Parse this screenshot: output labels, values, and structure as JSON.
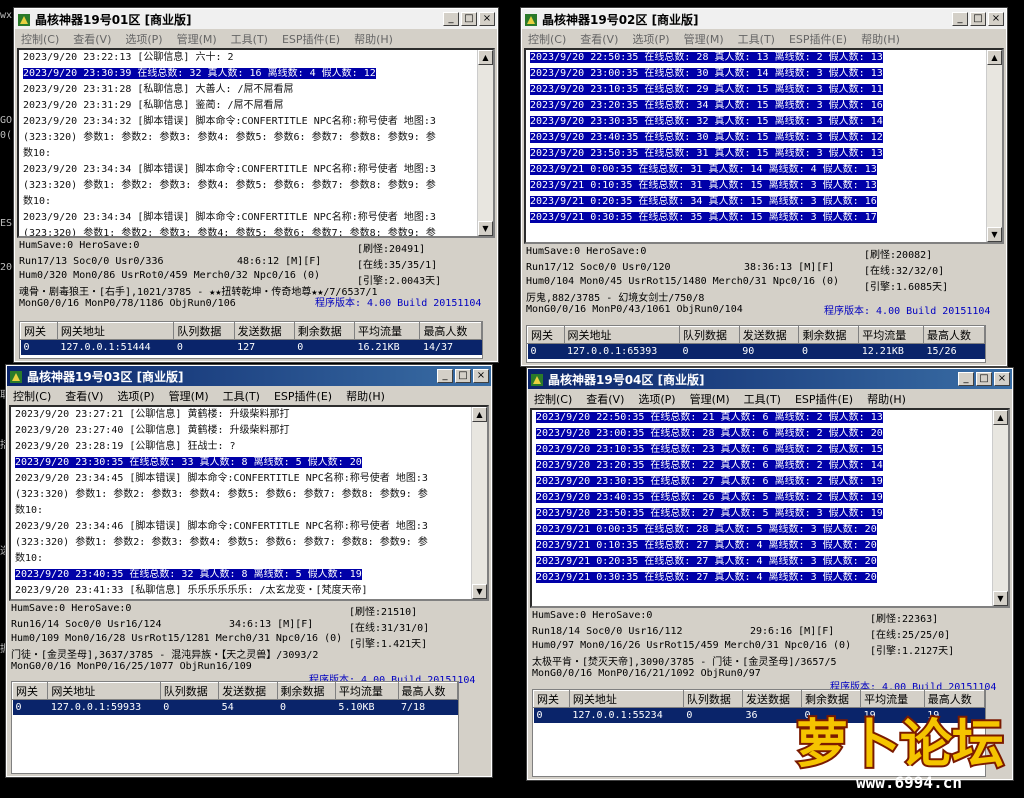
{
  "menus": [
    "控制(C)",
    "查看(V)",
    "选项(P)",
    "管理(M)",
    "工具(T)",
    "ESP插件(E)",
    "帮助(H)"
  ],
  "grid_headers": [
    "网关",
    "网关地址",
    "队列数据",
    "发送数据",
    "剩余数据",
    "平均流量",
    "最高人数"
  ],
  "title_buttons": {
    "min": "_",
    "max": "□",
    "close": "×"
  },
  "desktop_glyphs": [
    "wx",
    "GO",
    "0(",
    "ESP",
    "20",
    "取",
    "括",
    "选",
    "据"
  ],
  "windows": [
    {
      "title": "晶核神器19号01区 [商业版]",
      "log": [
        {
          "t": "2023/9/20 23:22:13 [公聊信息] 六十: 2",
          "hl": false
        },
        {
          "t": "2023/9/20 23:30:39 在线总数: 32 真人数: 16 离线数: 4 假人数: 12",
          "hl": true
        },
        {
          "t": "2023/9/20 23:31:28 [私聊信息] 大善人: /屌不屌看屌",
          "hl": false
        },
        {
          "t": "2023/9/20 23:31:29 [私聊信息] 鉴蔺: /屌不屌看屌",
          "hl": false
        },
        {
          "t": "2023/9/20 23:34:32 [脚本错误] 脚本命令:CONFERTITLE NPC名称:称号使者 地图:3",
          "hl": false
        },
        {
          "t": "(323:320) 参数1: 参数2: 参数3: 参数4: 参数5: 参数6: 参数7: 参数8: 参数9: 参",
          "hl": false
        },
        {
          "t": "数10:",
          "hl": false
        },
        {
          "t": "2023/9/20 23:34:34 [脚本错误] 脚本命令:CONFERTITLE NPC名称:称号使者 地图:3",
          "hl": false
        },
        {
          "t": "(323:320) 参数1: 参数2: 参数3: 参数4: 参数5: 参数6: 参数7: 参数8: 参数9: 参",
          "hl": false
        },
        {
          "t": "数10:",
          "hl": false
        },
        {
          "t": "2023/9/20 23:34:34 [脚本错误] 脚本命令:CONFERTITLE NPC名称:称号使者 地图:3",
          "hl": false
        },
        {
          "t": "(323:320) 参数1: 参数2: 参数3: 参数4: 参数5: 参数6: 参数7: 参数8: 参数9: 参",
          "hl": false
        }
      ],
      "status": {
        "l1": "HumSave:0 HeroSave:0",
        "l2": "Run17/13 Soc0/0 Usr0/336",
        "time": "48:6:12 [M][F]",
        "l3": "Hum0/320 Mon0/86 UsrRot0/459 Merch0/32 Npc0/16 (0)",
        "l4": "魂骨・剧毒狼王・[右手],1021/3785 - ★★扭转乾坤・传奇地尊★★/7/6537/1",
        "l5": "MonG0/0/16 MonP0/78/1186 ObjRun0/106",
        "r1": "[刷怪:20491]",
        "r2": "[在线:35/35/1]",
        "r3": "[引擎:2.0043天]",
        "ver": "程序版本: 4.00 Build 20151104"
      },
      "grid_row": [
        "0",
        "127.0.0.1:51444",
        "0",
        "127",
        "0",
        "16.21KB",
        "14/37"
      ]
    },
    {
      "title": "晶核神器19号02区 [商业版]",
      "log": [
        {
          "t": "2023/9/20 22:50:35 在线总数: 28 真人数: 13 离线数: 2 假人数: 13",
          "hl": true
        },
        {
          "t": "2023/9/20 23:00:35 在线总数: 30 真人数: 14 离线数: 3 假人数: 13",
          "hl": true
        },
        {
          "t": "2023/9/20 23:10:35 在线总数: 29 真人数: 15 离线数: 3 假人数: 11",
          "hl": true
        },
        {
          "t": "2023/9/20 23:20:35 在线总数: 34 真人数: 15 离线数: 3 假人数: 16",
          "hl": true
        },
        {
          "t": "2023/9/20 23:30:35 在线总数: 32 真人数: 15 离线数: 3 假人数: 14",
          "hl": true
        },
        {
          "t": "2023/9/20 23:40:35 在线总数: 30 真人数: 15 离线数: 3 假人数: 12",
          "hl": true
        },
        {
          "t": "2023/9/20 23:50:35 在线总数: 31 真人数: 15 离线数: 3 假人数: 13",
          "hl": true
        },
        {
          "t": "2023/9/21 0:00:35 在线总数: 31 真人数: 14 离线数: 4 假人数: 13",
          "hl": true
        },
        {
          "t": "2023/9/21 0:10:35 在线总数: 31 真人数: 15 离线数: 3 假人数: 13",
          "hl": true
        },
        {
          "t": "2023/9/21 0:20:35 在线总数: 34 真人数: 15 离线数: 3 假人数: 16",
          "hl": true
        },
        {
          "t": "2023/9/21 0:30:35 在线总数: 35 真人数: 15 离线数: 3 假人数: 17",
          "hl": true
        }
      ],
      "status": {
        "l1": "HumSave:0 HeroSave:0",
        "l2": "Run17/12 Soc0/0 Usr0/120",
        "time": "38:36:13 [M][F]",
        "l3": "Hum0/104 Mon0/45 UsrRot15/1480 Merch0/31 Npc0/16 (0)",
        "l4": "厉鬼,882/3785 - 幻境女剑士/750/8",
        "l5": "MonG0/0/16 MonP0/43/1061 ObjRun0/104",
        "r1": "[刷怪:20082]",
        "r2": "[在线:32/32/0]",
        "r3": "[引擎:1.6085天]",
        "ver": "程序版本: 4.00 Build 20151104"
      },
      "grid_row": [
        "0",
        "127.0.0.1:65393",
        "0",
        "90",
        "0",
        "12.21KB",
        "15/26"
      ]
    },
    {
      "title": "晶核神器19号03区 [商业版]",
      "log": [
        {
          "t": "2023/9/20 23:27:21 [公聊信息] 黄鹤楼: 升级柴料那打",
          "hl": false
        },
        {
          "t": "2023/9/20 23:27:40 [公聊信息] 黄鹤楼: 升级柴料那打",
          "hl": false
        },
        {
          "t": "2023/9/20 23:28:19 [公聊信息] 狂战士: ?",
          "hl": false
        },
        {
          "t": "2023/9/20 23:30:35 在线总数: 33 真人数: 8 离线数: 5 假人数: 20",
          "hl": true
        },
        {
          "t": "2023/9/20 23:34:45 [脚本错误] 脚本命令:CONFERTITLE NPC名称:称号使者 地图:3",
          "hl": false
        },
        {
          "t": "(323:320) 参数1: 参数2: 参数3: 参数4: 参数5: 参数6: 参数7: 参数8: 参数9: 参",
          "hl": false
        },
        {
          "t": "数10:",
          "hl": false
        },
        {
          "t": "2023/9/20 23:34:46 [脚本错误] 脚本命令:CONFERTITLE NPC名称:称号使者 地图:3",
          "hl": false
        },
        {
          "t": "(323:320) 参数1: 参数2: 参数3: 参数4: 参数5: 参数6: 参数7: 参数8: 参数9: 参",
          "hl": false
        },
        {
          "t": "数10:",
          "hl": false
        },
        {
          "t": "2023/9/20 23:40:35 在线总数: 32 真人数: 8 离线数: 5 假人数: 19",
          "hl": true
        },
        {
          "t": "2023/9/20 23:41:33 [私聊信息] 乐乐乐乐乐乐: /太玄龙变・[梵度天帝]",
          "hl": false
        }
      ],
      "status": {
        "l1": "HumSave:0 HeroSave:0",
        "l2": "Run16/14 Soc0/0 Usr16/124",
        "time": "34:6:13 [M][F]",
        "l3": "Hum0/109 Mon0/16/28 UsrRot15/1281 Merch0/31 Npc0/16 (0)",
        "l4": "门徒・[金灵圣母],3637/3785 - 混沌异族・【天之灵兽】/3093/2",
        "l5": "MonG0/0/16 MonP0/16/25/1077 ObjRun16/109",
        "r1": "[刷怪:21510]",
        "r2": "[在线:31/31/0]",
        "r3": "[引擎:1.421天]",
        "ver": "程序版本: 4.00 Build 20151104"
      },
      "grid_row": [
        "0",
        "127.0.0.1:59933",
        "0",
        "54",
        "0",
        "5.10KB",
        "7/18"
      ]
    },
    {
      "title": "晶核神器19号04区 [商业版]",
      "log": [
        {
          "t": "2023/9/20 22:50:35 在线总数: 21 真人数: 6 离线数: 2 假人数: 13",
          "hl": true
        },
        {
          "t": "2023/9/20 23:00:35 在线总数: 28 真人数: 6 离线数: 2 假人数: 20",
          "hl": true
        },
        {
          "t": "2023/9/20 23:10:35 在线总数: 23 真人数: 6 离线数: 2 假人数: 15",
          "hl": true
        },
        {
          "t": "2023/9/20 23:20:35 在线总数: 22 真人数: 6 离线数: 2 假人数: 14",
          "hl": true
        },
        {
          "t": "2023/9/20 23:30:35 在线总数: 27 真人数: 6 离线数: 2 假人数: 19",
          "hl": true
        },
        {
          "t": "2023/9/20 23:40:35 在线总数: 26 真人数: 5 离线数: 2 假人数: 19",
          "hl": true
        },
        {
          "t": "2023/9/20 23:50:35 在线总数: 27 真人数: 5 离线数: 3 假人数: 19",
          "hl": true
        },
        {
          "t": "2023/9/21 0:00:35 在线总数: 28 真人数: 5 离线数: 3 假人数: 20",
          "hl": true
        },
        {
          "t": "2023/9/21 0:10:35 在线总数: 27 真人数: 4 离线数: 3 假人数: 20",
          "hl": true
        },
        {
          "t": "2023/9/21 0:20:35 在线总数: 27 真人数: 4 离线数: 3 假人数: 20",
          "hl": true
        },
        {
          "t": "2023/9/21 0:30:35 在线总数: 27 真人数: 4 离线数: 3 假人数: 20",
          "hl": true
        }
      ],
      "status": {
        "l1": "HumSave:0 HeroSave:0",
        "l2": "Run18/14 Soc0/0 Usr16/112",
        "time": "29:6:16 [M][F]",
        "l3": "Hum0/97 Mon0/16/26 UsrRot15/459 Merch0/31 Npc0/16 (0)",
        "l4": "太极平肯・[焚灭天帝],3090/3785 - 门徒・[金灵圣母]/3657/5",
        "l5": "MonG0/0/16 MonP0/16/21/1092 ObjRun0/97",
        "r1": "[刷怪:22363]",
        "r2": "[在线:25/25/0]",
        "r3": "[引擎:1.2127天]",
        "ver": "程序版本: 4.00 Build 20151104"
      },
      "grid_row": [
        "0",
        "127.0.0.1:55234",
        "0",
        "36",
        "0",
        "19",
        "19"
      ]
    }
  ],
  "logo": {
    "text": "萝卜论坛",
    "url": "www.6994.cn"
  }
}
